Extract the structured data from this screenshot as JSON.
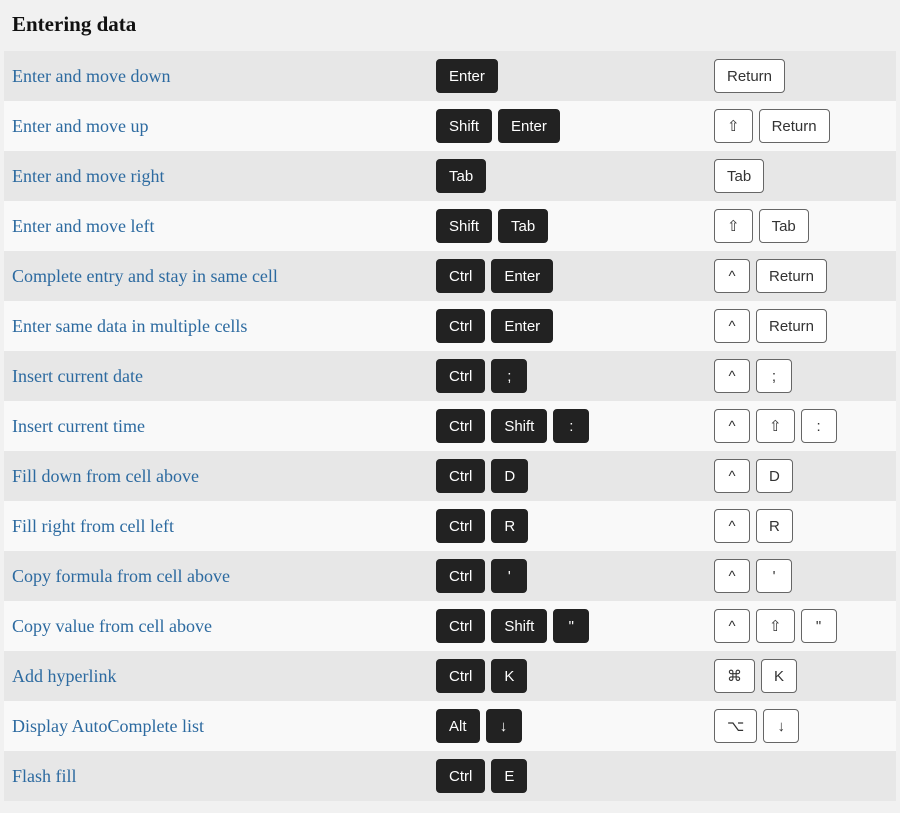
{
  "title": "Entering data",
  "shortcuts": [
    {
      "desc": "Enter and move down",
      "win": [
        "Enter"
      ],
      "mac": [
        "Return"
      ]
    },
    {
      "desc": "Enter and move up",
      "win": [
        "Shift",
        "Enter"
      ],
      "mac": [
        "⇧",
        "Return"
      ]
    },
    {
      "desc": "Enter and move right",
      "win": [
        "Tab"
      ],
      "mac": [
        "Tab"
      ]
    },
    {
      "desc": "Enter and move left",
      "win": [
        "Shift",
        "Tab"
      ],
      "mac": [
        "⇧",
        "Tab"
      ]
    },
    {
      "desc": "Complete entry and stay in same cell",
      "win": [
        "Ctrl",
        "Enter"
      ],
      "mac": [
        "^",
        "Return"
      ]
    },
    {
      "desc": "Enter same data in multiple cells",
      "win": [
        "Ctrl",
        "Enter"
      ],
      "mac": [
        "^",
        "Return"
      ]
    },
    {
      "desc": "Insert current date",
      "win": [
        "Ctrl",
        ";"
      ],
      "mac": [
        "^",
        ";"
      ]
    },
    {
      "desc": "Insert current time",
      "win": [
        "Ctrl",
        "Shift",
        ":"
      ],
      "mac": [
        "^",
        "⇧",
        ":"
      ]
    },
    {
      "desc": "Fill down from cell above",
      "win": [
        "Ctrl",
        "D"
      ],
      "mac": [
        "^",
        "D"
      ]
    },
    {
      "desc": "Fill right from cell left",
      "win": [
        "Ctrl",
        "R"
      ],
      "mac": [
        "^",
        "R"
      ]
    },
    {
      "desc": "Copy formula from cell above",
      "win": [
        "Ctrl",
        "'"
      ],
      "mac": [
        "^",
        "'"
      ]
    },
    {
      "desc": "Copy value from cell above",
      "win": [
        "Ctrl",
        "Shift",
        "\""
      ],
      "mac": [
        "^",
        "⇧",
        "\""
      ]
    },
    {
      "desc": "Add hyperlink",
      "win": [
        "Ctrl",
        "K"
      ],
      "mac": [
        "⌘",
        "K"
      ]
    },
    {
      "desc": "Display AutoComplete list",
      "win": [
        "Alt",
        "↓"
      ],
      "mac": [
        "⌥",
        "↓"
      ]
    },
    {
      "desc": "Flash fill",
      "win": [
        "Ctrl",
        "E"
      ],
      "mac": []
    }
  ]
}
